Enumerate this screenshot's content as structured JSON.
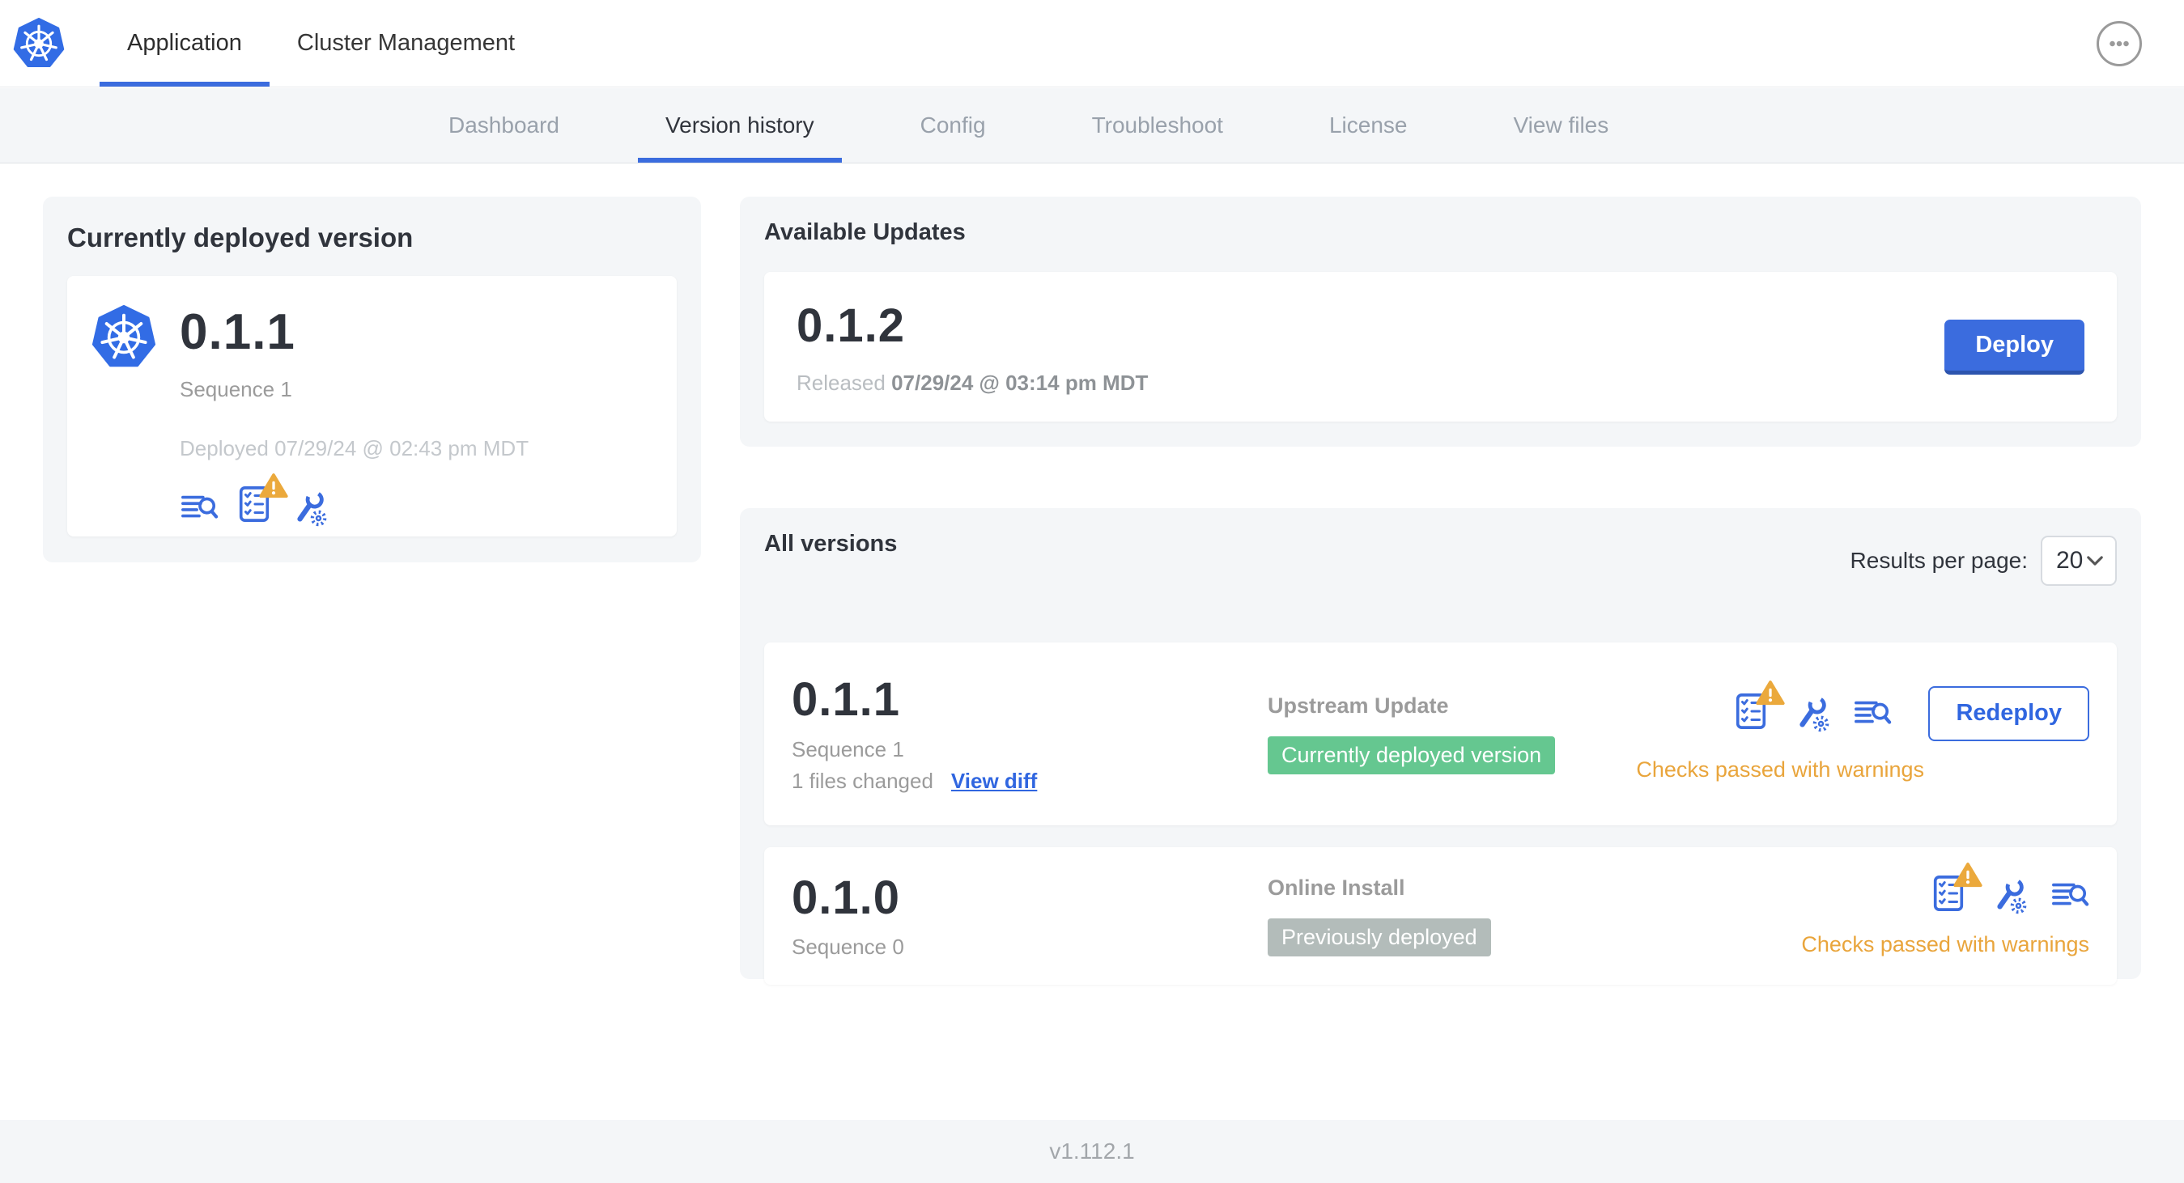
{
  "header": {
    "tabs": [
      {
        "label": "Application",
        "active": true
      },
      {
        "label": "Cluster Management",
        "active": false
      }
    ]
  },
  "subnav": {
    "tabs": [
      {
        "label": "Dashboard",
        "active": false
      },
      {
        "label": "Version history",
        "active": true
      },
      {
        "label": "Config",
        "active": false
      },
      {
        "label": "Troubleshoot",
        "active": false
      },
      {
        "label": "License",
        "active": false
      },
      {
        "label": "View files",
        "active": false
      }
    ]
  },
  "current_version": {
    "title": "Currently deployed version",
    "version": "0.1.1",
    "sequence": "Sequence 1",
    "deployed": "Deployed 07/29/24 @ 02:43 pm MDT"
  },
  "available_updates": {
    "title": "Available Updates",
    "version": "0.1.2",
    "released_label": "Released",
    "released_date": "07/29/24 @ 03:14 pm MDT",
    "deploy_button": "Deploy"
  },
  "all_versions": {
    "title": "All versions",
    "results_per_page_label": "Results per page:",
    "results_per_page": "20",
    "rows": [
      {
        "version": "0.1.1",
        "sequence": "Sequence 1",
        "files_changed": "1 files changed",
        "view_diff": "View diff",
        "source": "Upstream Update",
        "badge": "Currently deployed version",
        "badge_color": "#65c790",
        "status": "Checks passed with warnings",
        "action": "Redeploy"
      },
      {
        "version": "0.1.0",
        "sequence": "Sequence 0",
        "source": "Online Install",
        "badge": "Previously deployed",
        "badge_color": "#b3bcba",
        "status": "Checks passed with warnings"
      }
    ]
  },
  "footer": {
    "version": "v1.112.1"
  },
  "colors": {
    "k8s_blue": "#326ce5",
    "accent_blue": "#3b6cde",
    "success_green": "#65c790",
    "muted_badge_gray": "#b3bcba",
    "warning_amber": "#e9a53c"
  }
}
